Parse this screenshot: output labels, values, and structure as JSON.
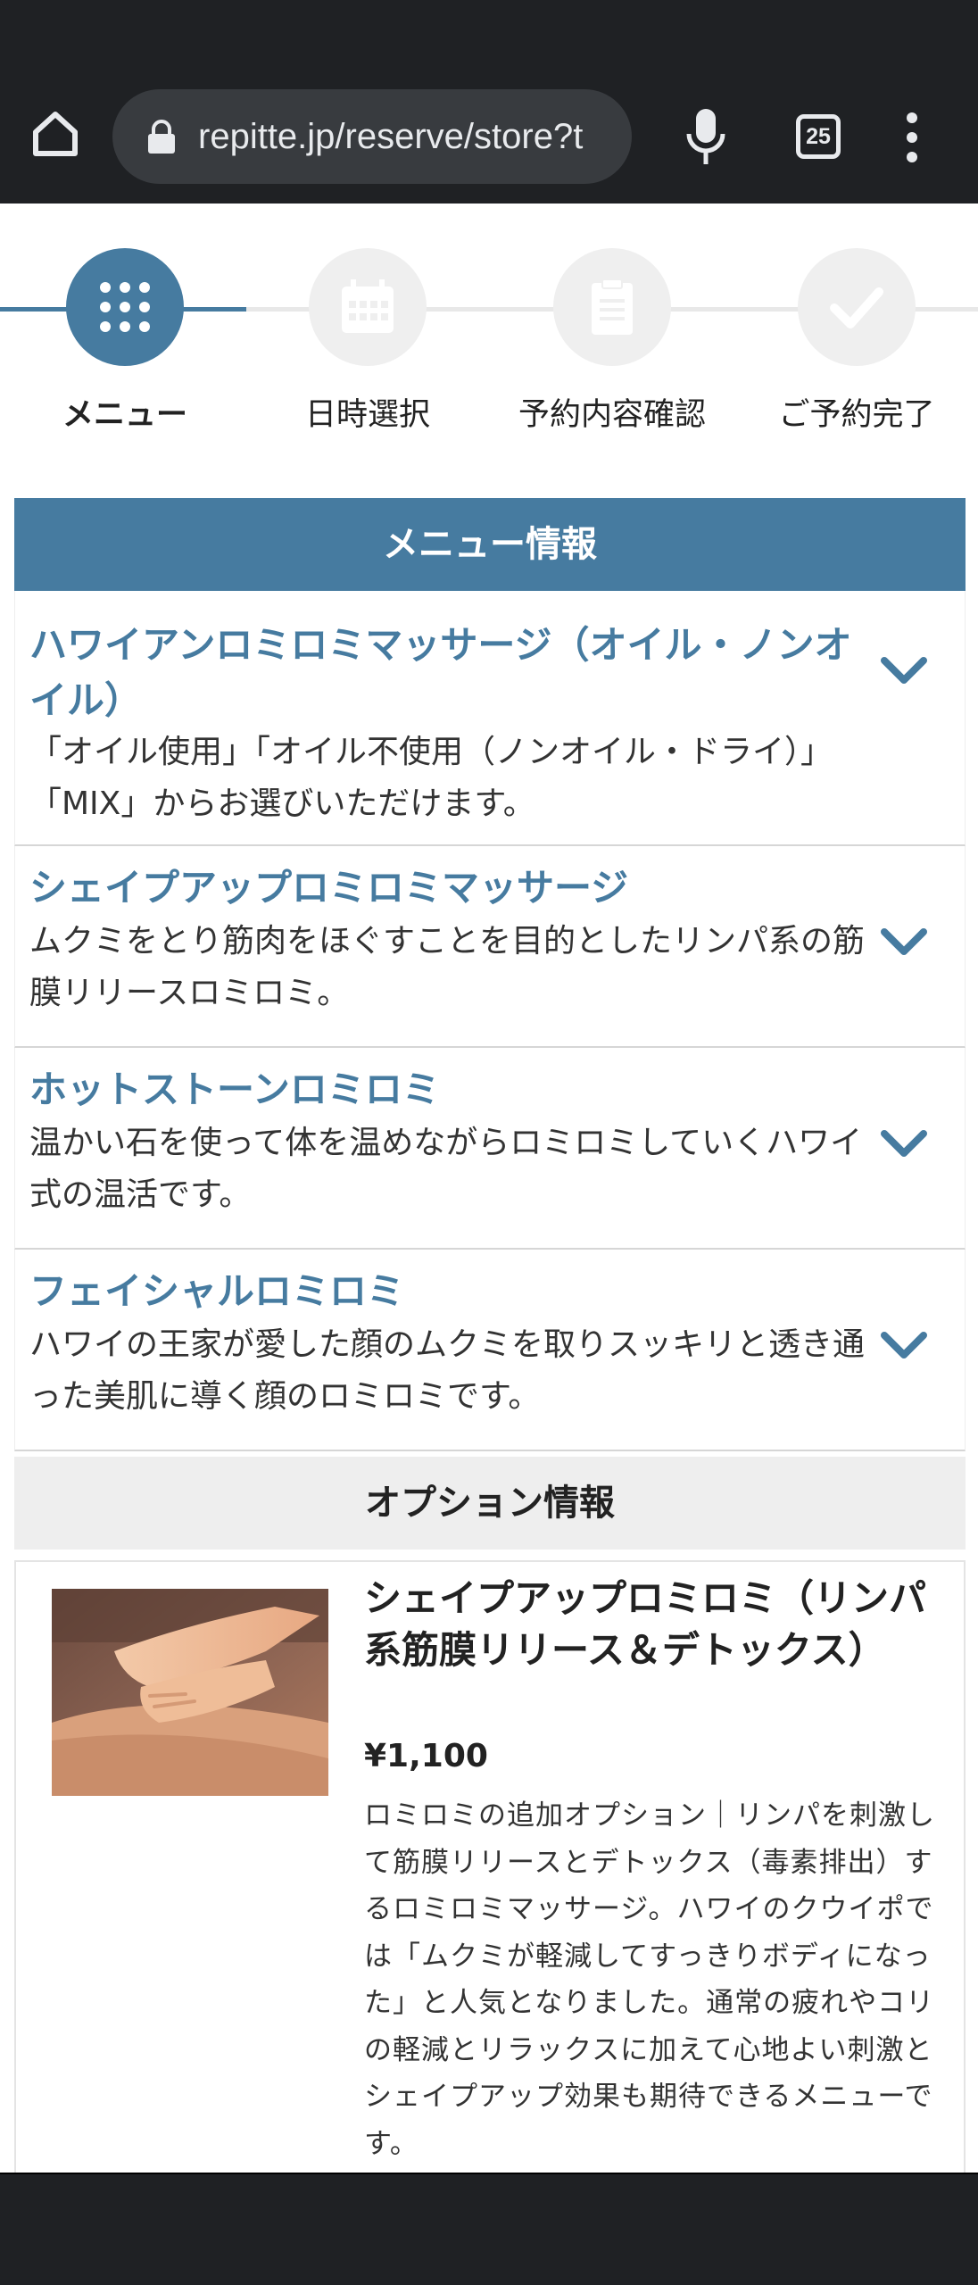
{
  "browser": {
    "url": "repitte.jp/reserve/store?t",
    "tab_count": "25"
  },
  "colors": {
    "accent": "#467ba0",
    "chrome_bg": "#1f2124"
  },
  "steps": [
    {
      "label": "メニュー",
      "icon": "grid-dots-icon",
      "active": true
    },
    {
      "label": "日時選択",
      "icon": "calendar-icon",
      "active": false
    },
    {
      "label": "予約内容確認",
      "icon": "clipboard-icon",
      "active": false
    },
    {
      "label": "ご予約完了",
      "icon": "check-icon",
      "active": false
    }
  ],
  "menu_section": {
    "title": "メニュー情報",
    "items": [
      {
        "title": "ハワイアンロミロミマッサージ（オイル・ノンオイル）",
        "desc": "「オイル使用」「オイル不使用（ノンオイル・ドライ）」「MIX」からお選びいただけます。"
      },
      {
        "title": "シェイプアップロミロミマッサージ",
        "desc": "ムクミをとり筋肉をほぐすことを目的としたリンパ系の筋膜リリースロミロミ。"
      },
      {
        "title": "ホットストーンロミロミ",
        "desc": "温かい石を使って体を温めながらロミロミしていくハワイ式の温活です。"
      },
      {
        "title": "フェイシャルロミロミ",
        "desc": "ハワイの王家が愛した顔のムクミを取りスッキリと透き通った美肌に導く顔のロミロミです。"
      }
    ]
  },
  "option_section": {
    "title": "オプション情報",
    "item": {
      "title": "シェイプアップロミロミ（リンパ系筋膜リリース＆デトックス）",
      "price": "¥1,100",
      "desc": "ロミロミの追加オプション｜リンパを刺激して筋膜リリースとデトックス（毒素排出）するロミロミマッサージ。ハワイのクウイポでは「ムクミが軽減してすっきりボディになった」と人気となりました。通常の疲れやコリの軽減とリラックスに加えて心地よい刺激とシェイプアップ効果も期待できるメニューです。"
    }
  }
}
